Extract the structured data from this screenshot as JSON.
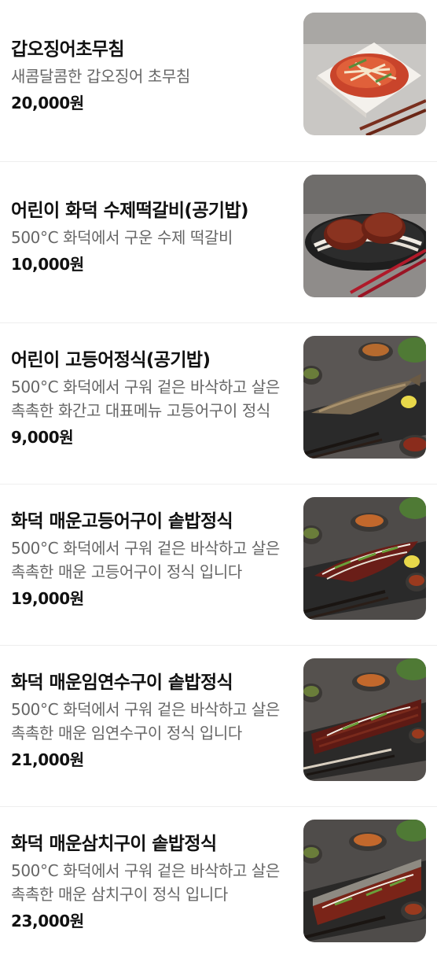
{
  "menu": {
    "items": [
      {
        "name": "갑오징어초무침",
        "description": "새콤달콤한 갑오징어 초무침",
        "price": "20,000원",
        "image_icon": "spicy-squid-salad-photo"
      },
      {
        "name": "어린이 화덕 수제떡갈비(공기밥)",
        "description": "500°C 화덕에서 구운 수제 떡갈비",
        "price": "10,000원",
        "image_icon": "grilled-patties-photo"
      },
      {
        "name": "어린이 고등어정식(공기밥)",
        "description": "500°C 화덕에서 구워 겉은 바삭하고 살은 촉촉한 화간고 대표메뉴 고등어구이 정식",
        "price": "9,000원",
        "image_icon": "grilled-mackerel-photo"
      },
      {
        "name": "화덕 매운고등어구이 솥밥정식",
        "description": "500°C 화덕에서 구워 겉은 바삭하고 살은 촉촉한 매운 고등어구이 정식 입니다",
        "price": "19,000원",
        "image_icon": "spicy-mackerel-photo"
      },
      {
        "name": "화덕 매운임연수구이 솥밥정식",
        "description": "500°C 화덕에서 구워 겉은 바삭하고 살은 촉촉한 매운 임연수구이 정식 입니다",
        "price": "21,000원",
        "image_icon": "spicy-atka-mackerel-photo"
      },
      {
        "name": "화덕 매운삼치구이 솥밥정식",
        "description": "500°C 화덕에서 구워 겉은 바삭하고 살은 촉촉한 매운 삼치구이 정식 입니다",
        "price": "23,000원",
        "image_icon": "spicy-spanish-mackerel-photo"
      }
    ]
  }
}
